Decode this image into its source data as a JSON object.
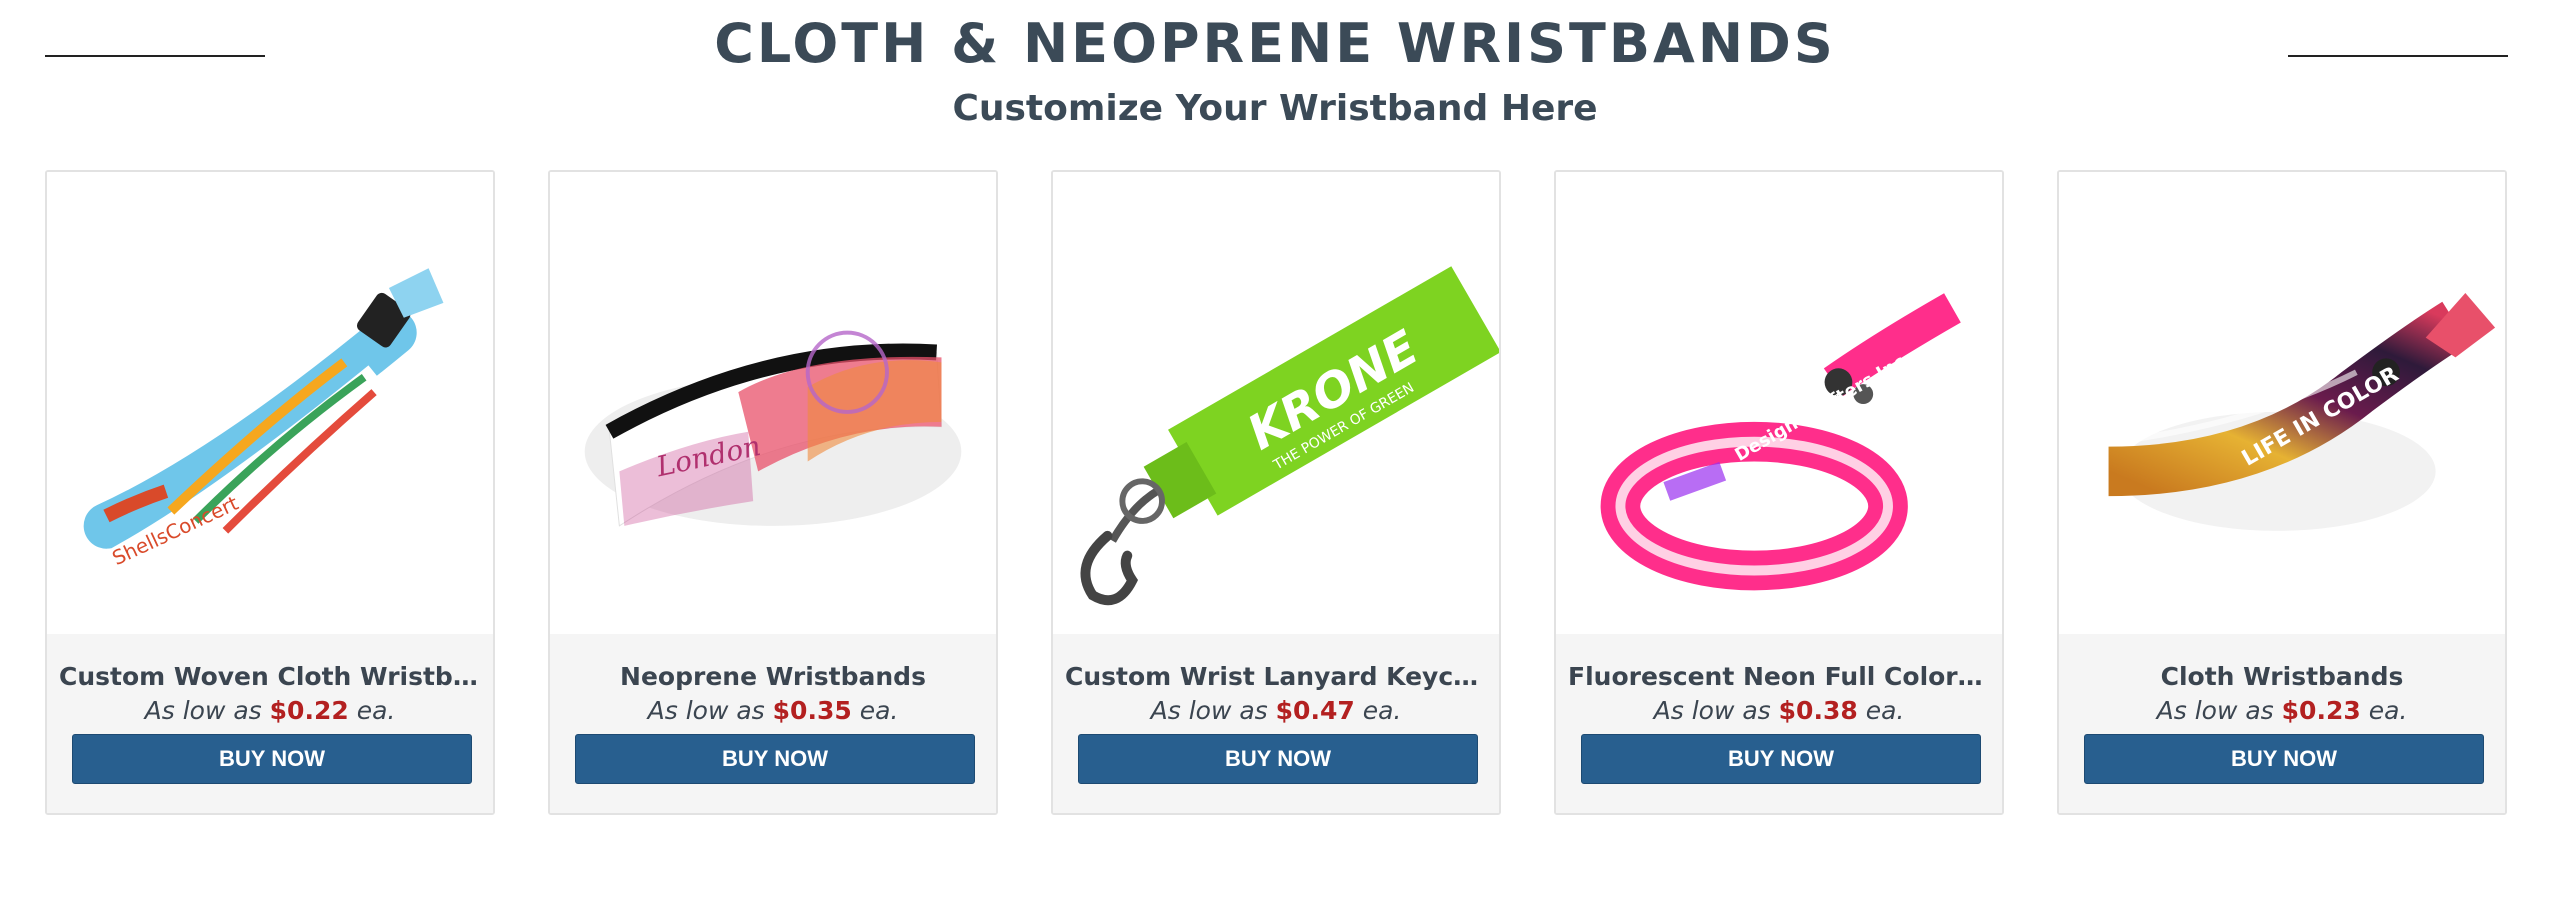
{
  "header": {
    "title": "CLOTH & NEOPRENE WRISTBANDS",
    "subtitle": "Customize Your Wristband Here"
  },
  "products": [
    {
      "name": "Custom Woven Cloth Wristbands",
      "price_prefix": "As low as",
      "price": "$0.22",
      "price_suffix": "ea.",
      "button": "BUY NOW",
      "image_text": "ShellsConcert"
    },
    {
      "name": "Neoprene Wristbands",
      "price_prefix": "As low as",
      "price": "$0.35",
      "price_suffix": "ea.",
      "button": "BUY NOW",
      "image_text": "London"
    },
    {
      "name": "Custom Wrist Lanyard Keychains",
      "price_prefix": "As low as",
      "price": "$0.47",
      "price_suffix": "ea.",
      "button": "BUY NOW",
      "image_text": "KRONE",
      "image_subtext": "THE POWER OF GREEN"
    },
    {
      "name": "Fluorescent Neon Full Color Cloth...",
      "price_prefix": "As low as",
      "price": "$0.38",
      "price_suffix": "ea.",
      "button": "BUY NOW",
      "image_text": "Design Crafters Inc."
    },
    {
      "name": "Cloth Wristbands",
      "price_prefix": "As low as",
      "price": "$0.23",
      "price_suffix": "ea.",
      "button": "BUY NOW",
      "image_text": "LIFE IN COLOR"
    }
  ],
  "colors": {
    "heading": "#3b4a57",
    "price": "#b32020",
    "button": "#285f8f"
  }
}
